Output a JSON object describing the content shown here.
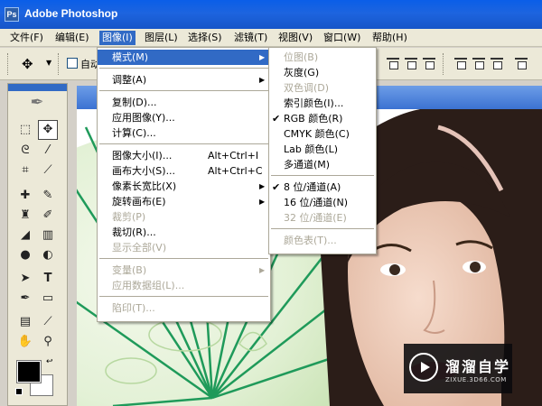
{
  "window": {
    "title": "Adobe Photoshop",
    "logo_text": "Ps"
  },
  "menubar": {
    "file": "文件(F)",
    "edit": "编辑(E)",
    "image": "图像(I)",
    "layer": "图层(L)",
    "select": "选择(S)",
    "filter": "滤镜(T)",
    "view": "视图(V)",
    "window": "窗口(W)",
    "help": "帮助(H)"
  },
  "options": {
    "tool_icon": "move-tool-icon",
    "checkbox_label": "自动"
  },
  "toolbox": {
    "tools": [
      "marquee-icon",
      "move-icon",
      "lasso-icon",
      "magic-wand-icon",
      "crop-icon",
      "slice-icon",
      "healing-brush-icon",
      "brush-icon",
      "stamp-icon",
      "history-brush-icon",
      "eraser-icon",
      "gradient-icon",
      "blur-icon",
      "dodge-icon",
      "path-select-icon",
      "type-icon",
      "pen-icon",
      "shape-icon",
      "notes-icon",
      "eyedropper-icon",
      "hand-icon",
      "zoom-icon"
    ],
    "fg_color": "#000000",
    "bg_color": "#ffffff"
  },
  "image_menu": {
    "items": [
      {
        "label": "模式(M)",
        "shortcut": "",
        "submenu": true,
        "enabled": true,
        "highlighted": true
      },
      {
        "separator": true
      },
      {
        "label": "调整(A)",
        "shortcut": "",
        "submenu": true,
        "enabled": true
      },
      {
        "separator": true
      },
      {
        "label": "复制(D)...",
        "shortcut": "",
        "enabled": true
      },
      {
        "label": "应用图像(Y)...",
        "shortcut": "",
        "enabled": true
      },
      {
        "label": "计算(C)...",
        "shortcut": "",
        "enabled": true
      },
      {
        "separator": true
      },
      {
        "label": "图像大小(I)...",
        "shortcut": "Alt+Ctrl+I",
        "enabled": true
      },
      {
        "label": "画布大小(S)...",
        "shortcut": "Alt+Ctrl+C",
        "enabled": true
      },
      {
        "label": "像素长宽比(X)",
        "shortcut": "",
        "submenu": true,
        "enabled": true
      },
      {
        "label": "旋转画布(E)",
        "shortcut": "",
        "submenu": true,
        "enabled": true
      },
      {
        "label": "裁剪(P)",
        "shortcut": "",
        "enabled": false
      },
      {
        "label": "裁切(R)...",
        "shortcut": "",
        "enabled": true
      },
      {
        "label": "显示全部(V)",
        "shortcut": "",
        "enabled": false
      },
      {
        "separator": true
      },
      {
        "label": "变量(B)",
        "shortcut": "",
        "submenu": true,
        "enabled": false
      },
      {
        "label": "应用数据组(L)...",
        "shortcut": "",
        "enabled": false
      },
      {
        "separator": true
      },
      {
        "label": "陷印(T)...",
        "shortcut": "",
        "enabled": false
      }
    ]
  },
  "mode_menu": {
    "items": [
      {
        "label": "位图(B)",
        "enabled": false,
        "checked": false
      },
      {
        "label": "灰度(G)",
        "enabled": true,
        "checked": false
      },
      {
        "label": "双色调(D)",
        "enabled": false,
        "checked": false
      },
      {
        "label": "索引颜色(I)...",
        "enabled": true,
        "checked": false
      },
      {
        "label": "RGB 颜色(R)",
        "enabled": true,
        "checked": true
      },
      {
        "label": "CMYK 颜色(C)",
        "enabled": true,
        "checked": false
      },
      {
        "label": "Lab 颜色(L)",
        "enabled": true,
        "checked": false
      },
      {
        "label": "多通道(M)",
        "enabled": true,
        "checked": false
      },
      {
        "separator": true
      },
      {
        "label": "8 位/通道(A)",
        "enabled": true,
        "checked": true
      },
      {
        "label": "16 位/通道(N)",
        "enabled": true,
        "checked": false
      },
      {
        "label": "32 位/通道(E)",
        "enabled": false,
        "checked": false
      },
      {
        "separator": true
      },
      {
        "label": "颜色表(T)...",
        "enabled": false,
        "checked": false
      }
    ]
  },
  "watermark": {
    "title": "溜溜自学",
    "url": "ZIXUE.3D66.COM"
  },
  "colors": {
    "highlight": "#316ac5",
    "menu_bg": "#ffffff",
    "disabled_text": "#aca899",
    "umbrella_rib": "#1f9a5a"
  }
}
